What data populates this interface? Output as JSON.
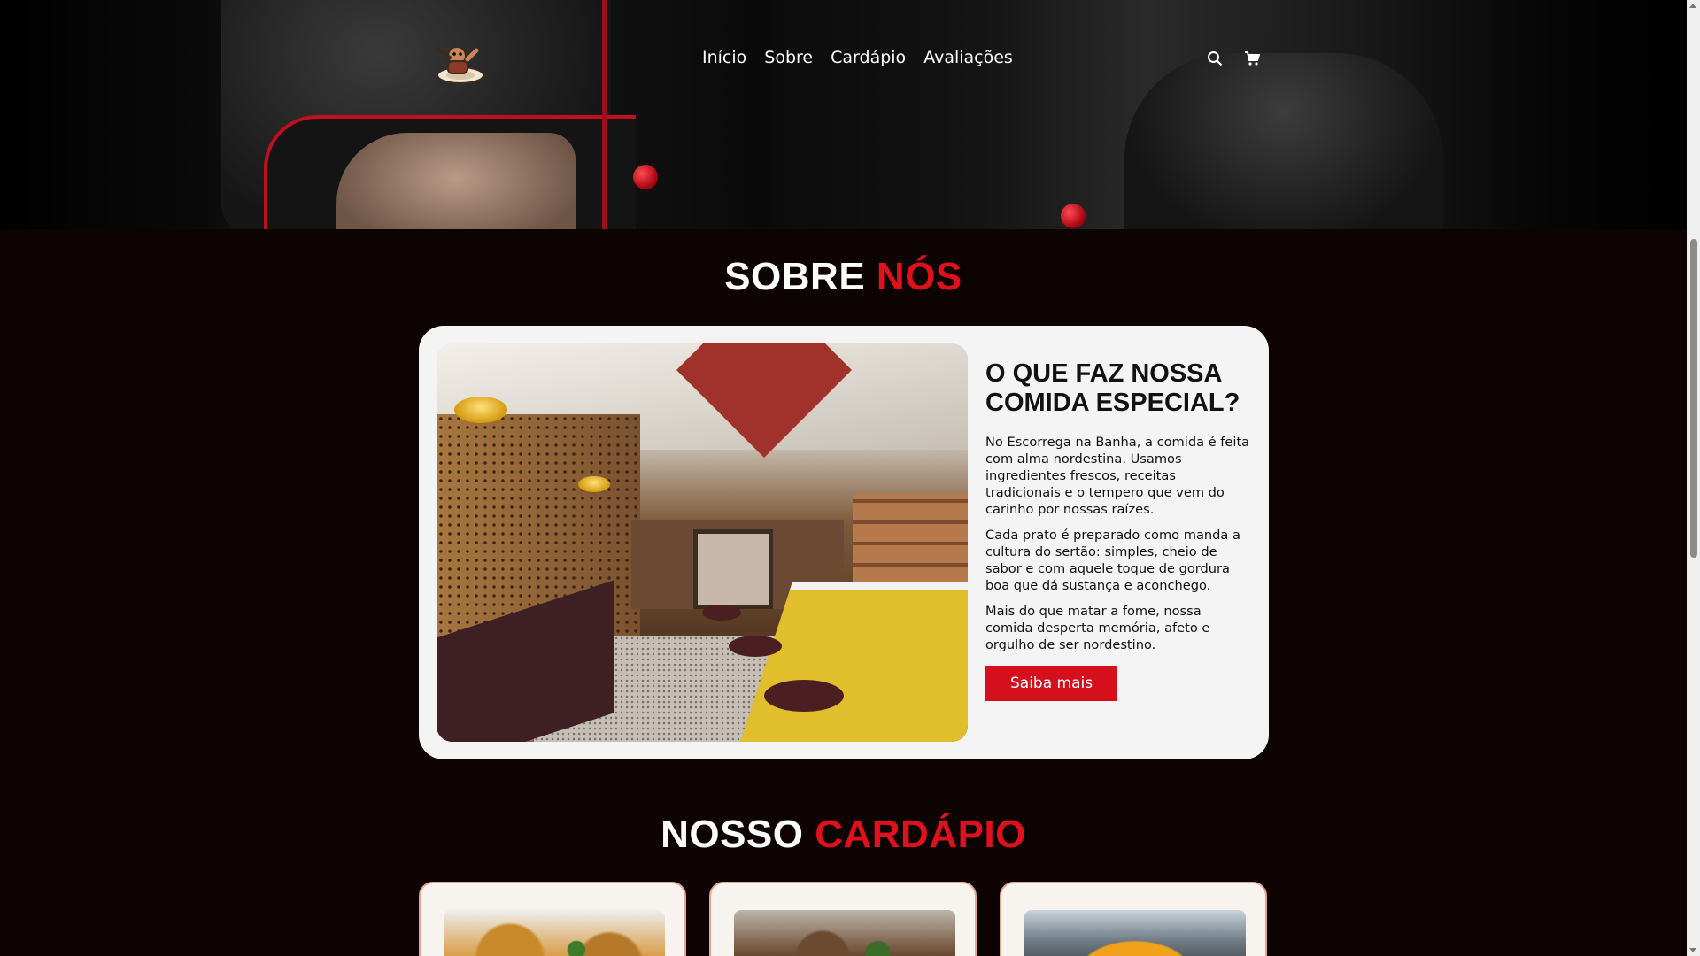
{
  "nav": {
    "items": [
      "Início",
      "Sobre",
      "Cardápio",
      "Avaliações"
    ],
    "logo_icon": "mascot-logo",
    "search_icon": "search-icon",
    "cart_icon": "cart-icon"
  },
  "about": {
    "title_white": "SOBRE",
    "title_red": "NÓS",
    "heading": "O QUE FAZ NOSSA COMIDA ESPECIAL?",
    "paragraphs": [
      "No Escorrega na Banha, a comida é feita com alma nordestina. Usamos ingredientes frescos, receitas tradicionais e o tempero que vem do carinho por nossas raízes.",
      "Cada prato é preparado como manda a cultura do sertão: simples, cheio de sabor e com aquele toque de gordura boa que dá sustança e aconchego.",
      "Mais do que matar a fome, nossa comida desperta memória, afeto e orgulho de ser nordestino."
    ],
    "button_label": "Saiba mais"
  },
  "menu_section": {
    "title_white": "NOSSO",
    "title_red": "CARDÁPIO"
  },
  "colors": {
    "accent": "#e0101c",
    "background": "#0d0303",
    "card": "#f5f4f4"
  }
}
